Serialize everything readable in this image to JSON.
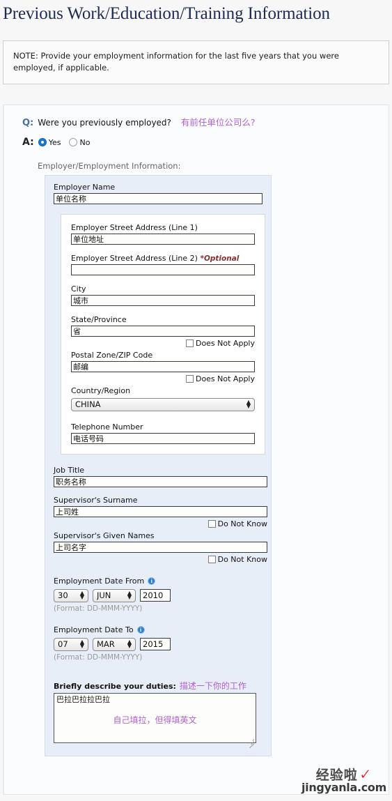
{
  "page": {
    "title": "Previous Work/Education/Training Information"
  },
  "note": {
    "text": "NOTE: Provide your employment information for the last five years that you were employed, if applicable."
  },
  "question": {
    "q_marker": "Q:",
    "a_marker": "A:",
    "text": "Were you previously employed?",
    "translation": "有前任单位公司么?",
    "answers": [
      {
        "label": "Yes",
        "selected": true
      },
      {
        "label": "No",
        "selected": false
      }
    ],
    "section_heading": "Employer/Employment Information:"
  },
  "employer": {
    "name_label": "Employer Name",
    "name_value": "单位名称",
    "address": {
      "line1_label": "Employer Street Address (Line 1)",
      "line1_value": "单位地址",
      "line2_label": "Employer Street Address (Line 2)",
      "line2_optional": "*Optional",
      "line2_value": "",
      "city_label": "City",
      "city_value": "城市",
      "state_label": "State/Province",
      "state_value": "省",
      "state_dna_label": "Does Not Apply",
      "postal_label": "Postal Zone/ZIP Code",
      "postal_value": "邮编",
      "postal_dna_label": "Does Not Apply",
      "country_label": "Country/Region",
      "country_value": "CHINA",
      "phone_label": "Telephone Number",
      "phone_value": "电话号码"
    },
    "job_title_label": "Job Title",
    "job_title_value": "职务名称",
    "supervisor_surname_label": "Supervisor's Surname",
    "supervisor_surname_value": "上司姓",
    "supervisor_surname_dnk_label": "Do Not Know",
    "supervisor_given_label": "Supervisor's Given Names",
    "supervisor_given_value": "上司名字",
    "supervisor_given_dnk_label": "Do Not Know",
    "date_from": {
      "label": "Employment Date From",
      "day": "30",
      "month": "JUN",
      "year": "2010",
      "format": "(Format: DD-MMM-YYYY)"
    },
    "date_to": {
      "label": "Employment Date To",
      "day": "07",
      "month": "MAR",
      "year": "2015",
      "format": "(Format: DD-MMM-YYYY)"
    },
    "duties": {
      "label": "Briefly describe your duties:",
      "translation": "描述一下你的工作",
      "value": "巴拉巴拉拉巴拉",
      "annotation": "自己填拉，但得填英文"
    }
  },
  "watermark": {
    "cn": "经验啦",
    "check": "✓",
    "url": "jingyanla.com"
  },
  "colors": {
    "title": "#1f2a52",
    "q_marker": "#4a6fa5",
    "translation": "#b05fd6",
    "optional": "#8a2f2f",
    "panel_blue": "#e8eef7",
    "radio_on": "#1878d0",
    "watermark_check": "#e11919"
  }
}
